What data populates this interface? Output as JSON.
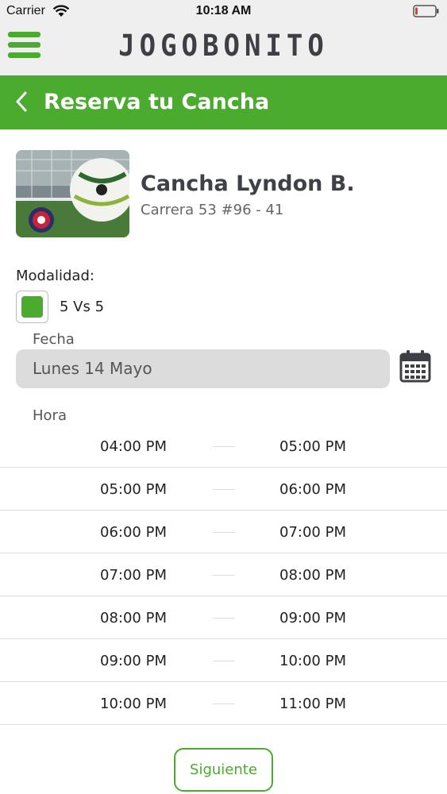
{
  "status_bar": {
    "carrier": "Carrier",
    "time": "10:18 AM"
  },
  "header": {
    "brand": "JOGOBONITO"
  },
  "title_bar": {
    "title": "Reserva tu Cancha"
  },
  "venue": {
    "name": "Cancha Lyndon B.",
    "address": "Carrera 53 #96 - 41"
  },
  "modalidad": {
    "label": "Modalidad:",
    "option": "5 Vs 5",
    "selected": true
  },
  "fecha": {
    "label": "Fecha",
    "value": "Lunes 14 Mayo"
  },
  "hora": {
    "label": "Hora",
    "slots": [
      {
        "start": "04:00 PM",
        "end": "05:00 PM"
      },
      {
        "start": "05:00 PM",
        "end": "06:00 PM"
      },
      {
        "start": "06:00 PM",
        "end": "07:00 PM"
      },
      {
        "start": "07:00 PM",
        "end": "08:00 PM"
      },
      {
        "start": "08:00 PM",
        "end": "09:00 PM"
      },
      {
        "start": "09:00 PM",
        "end": "10:00 PM"
      },
      {
        "start": "10:00 PM",
        "end": "11:00 PM"
      }
    ]
  },
  "actions": {
    "next_label": "Siguiente"
  },
  "colors": {
    "accent": "#4aab2f",
    "header_bg": "#efefef",
    "input_bg": "#dcdcdc",
    "battery_low": "#e23b3b"
  },
  "icons": {
    "menu": "hamburger-icon",
    "back": "chevron-left-icon",
    "calendar": "calendar-icon",
    "wifi": "wifi-icon",
    "battery": "battery-icon"
  }
}
